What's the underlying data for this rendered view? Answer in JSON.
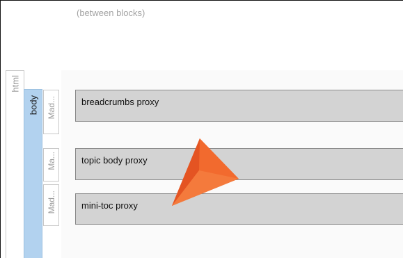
{
  "hint": {
    "text": "(between blocks)"
  },
  "structure_strips": {
    "html_label": "html",
    "body_label": "body",
    "margin_labels": [
      "Mad...",
      "Ma...",
      "Mad..."
    ]
  },
  "proxies": [
    {
      "label": "breadcrumbs proxy"
    },
    {
      "label": "topic body proxy"
    },
    {
      "label": "mini-toc proxy"
    }
  ],
  "colors": {
    "body_strip": "#b2d2ef",
    "proxy_fill": "#d3d3d3",
    "pointer": "#f26a2e",
    "hint_text": "#a3a3a3"
  },
  "icons": {
    "pointer": "orange-pointer-arrow-icon"
  }
}
